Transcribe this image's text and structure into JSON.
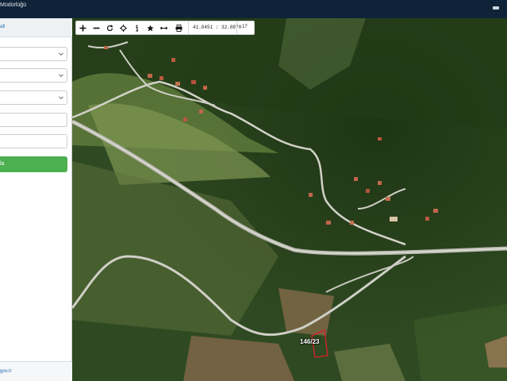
{
  "header": {
    "title": "Müdürlüğü"
  },
  "panel": {
    "title": "afi",
    "selects": [
      {
        "value": ""
      },
      {
        "value": ""
      },
      {
        "value": ""
      }
    ],
    "inputs": [
      {
        "value": ""
      },
      {
        "value": ""
      }
    ],
    "query_button": "la",
    "footer_link": "gov.tr"
  },
  "toolbar": {
    "tools": [
      "zoom-in-icon",
      "zoom-out-icon",
      "refresh-icon",
      "locate-icon",
      "info-icon",
      "favorite-icon",
      "measure-icon",
      "print-icon"
    ],
    "coordinates": "41.0451 : 32.8870",
    "zoom_level": "17"
  },
  "map": {
    "parcel_label": "146/23",
    "parcel_color": "#d8202a"
  },
  "colors": {
    "topbar": "#0f2338",
    "accent_green": "#4caf50",
    "link_blue": "#1f6ab0"
  }
}
